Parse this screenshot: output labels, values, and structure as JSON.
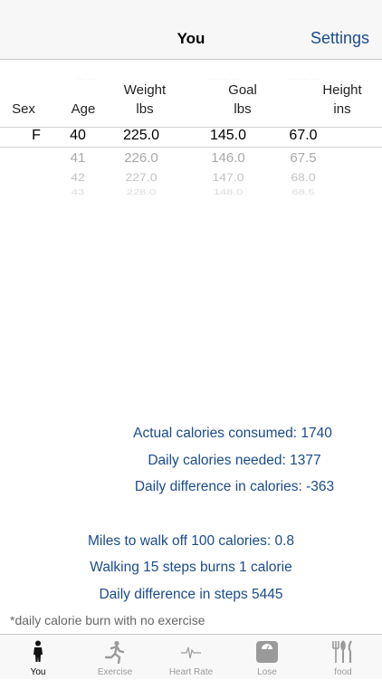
{
  "nav": {
    "title": "You",
    "right_button": "Settings"
  },
  "picker": {
    "headers": {
      "sex": "Sex",
      "age": "Age",
      "weight": [
        "Weight",
        "lbs"
      ],
      "goal": [
        "Goal",
        "lbs"
      ],
      "height": [
        "Height",
        "ins"
      ]
    },
    "selected": {
      "sex": "F",
      "age": "40",
      "weight": "225.0",
      "goal": "145.0",
      "height": "67.0"
    },
    "below": {
      "age": [
        "41",
        "42",
        "43"
      ],
      "weight": [
        "226.0",
        "227.0",
        "228.0"
      ],
      "goal": [
        "146.0",
        "147.0",
        "148.0"
      ],
      "height": [
        "67.5",
        "68.0",
        "68.5"
      ]
    }
  },
  "stats": {
    "actual": "Actual calories consumed: 1740",
    "needed": "Daily calories needed: 1377",
    "difference": "Daily difference in calories: -363",
    "miles": "Miles to walk off 100 calories: 0.8",
    "steps_per_cal": "Walking 15 steps burns 1 calorie",
    "steps_diff": "Daily difference in steps 5445"
  },
  "footnote": "*daily calorie burn with no exercise",
  "tabs": [
    {
      "label": "You",
      "icon": "person-icon",
      "active": true
    },
    {
      "label": "Exercise",
      "icon": "runner-icon",
      "active": false
    },
    {
      "label": "Heart Rate",
      "icon": "heartbeat-icon",
      "active": false
    },
    {
      "label": "Lose",
      "icon": "scale-icon",
      "active": false
    },
    {
      "label": "food",
      "icon": "utensils-icon",
      "active": false
    }
  ],
  "colors": {
    "accent": "#1a4b8c",
    "tab_inactive": "#9a9a9a"
  }
}
